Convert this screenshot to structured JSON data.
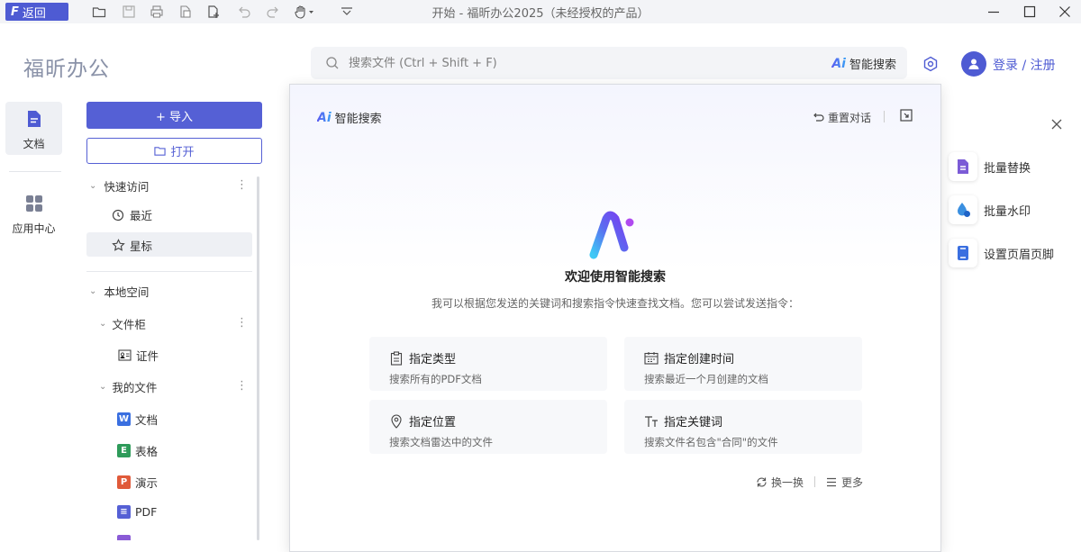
{
  "titlebar": {
    "back_label": "返回",
    "window_title": "开始 - 福昕办公2025（未经授权的产品）",
    "icons": [
      "open-folder-icon",
      "save-icon",
      "print-icon",
      "copy-file-icon",
      "new-file-icon",
      "undo-icon",
      "redo-icon",
      "hand-tool-icon",
      "customize-toolbar-icon"
    ],
    "window_controls": [
      "minimize-icon",
      "maximize-icon",
      "close-icon"
    ]
  },
  "header": {
    "brand": "福昕办公",
    "search_placeholder": "搜索文件 (Ctrl + Shift + F)",
    "smart_search_label": "智能搜索",
    "login_label": "登录 / 注册"
  },
  "rail": {
    "items": [
      {
        "label": "文档",
        "icon": "document-icon",
        "active": true
      },
      {
        "label": "应用中心",
        "icon": "apps-grid-icon",
        "active": false
      }
    ]
  },
  "sidebar": {
    "import_label": "+ 导入",
    "open_label": "打开",
    "quick_access": "快速访问",
    "recent": "最近",
    "starred": "星标",
    "local_space": "本地空间",
    "file_cabinet": "文件柜",
    "id_docs": "证件",
    "my_files": "我的文件",
    "files": [
      {
        "label": "文档",
        "badge": "W",
        "color": "#3a6fe0"
      },
      {
        "label": "表格",
        "badge": "E",
        "color": "#2e9b5a"
      },
      {
        "label": "演示",
        "badge": "P",
        "color": "#e05a3a"
      },
      {
        "label": "PDF",
        "badge": "≡",
        "color": "#5560d5"
      }
    ]
  },
  "panel": {
    "title": "智能搜索",
    "reset_label": "重置对话",
    "welcome": "欢迎使用智能搜索",
    "intro": "我可以根据您发送的关键词和搜索指令快速查找文档。您可以尝试发送指令：",
    "suggestions": [
      {
        "title": "指定类型",
        "desc": "搜索所有的PDF文档",
        "icon": "clipboard-icon"
      },
      {
        "title": "指定创建时间",
        "desc": "搜索最近一个月创建的文档",
        "icon": "calendar-icon"
      },
      {
        "title": "指定位置",
        "desc": "搜索文档雷达中的文件",
        "icon": "location-pin-icon"
      },
      {
        "title": "指定关键词",
        "desc": "搜索文件名包含\"合同\"的文件",
        "icon": "text-type-icon"
      }
    ],
    "refresh_label": "换一换",
    "more_label": "更多"
  },
  "tools": {
    "items": [
      {
        "label": "批量替换",
        "icon": "batch-replace-icon",
        "color": "#7b5bd6"
      },
      {
        "label": "批量水印",
        "icon": "watermark-icon",
        "color": "#3a8fe0"
      },
      {
        "label": "设置页眉页脚",
        "icon": "header-footer-icon",
        "color": "#3a6fe0"
      }
    ]
  },
  "colors": {
    "accent": "#4e5bd3",
    "titlebar_bg": "#f3f4f7"
  }
}
